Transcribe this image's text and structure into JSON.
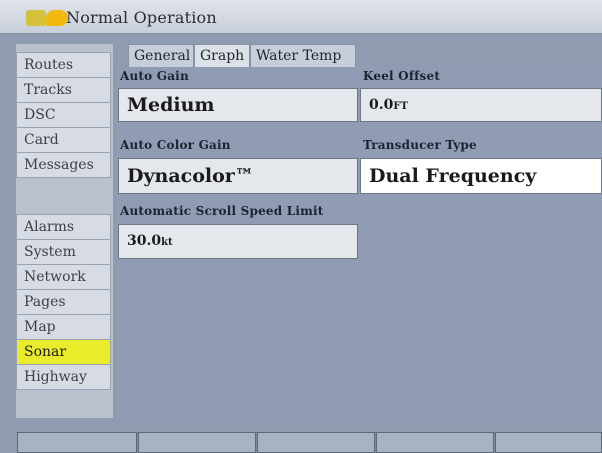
{
  "window": {
    "title": "Normal Operation"
  },
  "sidebar": {
    "items": [
      {
        "label": "Routes"
      },
      {
        "label": "Tracks"
      },
      {
        "label": "DSC"
      },
      {
        "label": "Card"
      },
      {
        "label": "Messages"
      },
      {
        "label": "Alarms"
      },
      {
        "label": "System"
      },
      {
        "label": "Network"
      },
      {
        "label": "Pages"
      },
      {
        "label": "Map"
      },
      {
        "label": "Sonar",
        "selected": true
      },
      {
        "label": "Highway"
      }
    ]
  },
  "tabs": [
    {
      "label": "General"
    },
    {
      "label": "Graph",
      "active": true
    },
    {
      "label": "Water Temp"
    }
  ],
  "fields": {
    "auto_gain": {
      "label": "Auto Gain",
      "value": "Medium"
    },
    "keel_offset": {
      "label": "Keel Offset",
      "value": "0.0",
      "unit": "FT"
    },
    "auto_color_gain": {
      "label": "Auto Color Gain",
      "value": "Dynacolor™"
    },
    "transducer_type": {
      "label": "Transducer Type",
      "value": "Dual Frequency"
    },
    "scroll_speed_limit": {
      "label": "Automatic Scroll Speed Limit",
      "value": "30.0",
      "unit": "kt"
    }
  },
  "colors": {
    "selected_highlight": "#e8ec2a",
    "panel_background": "#8f9cb3"
  }
}
